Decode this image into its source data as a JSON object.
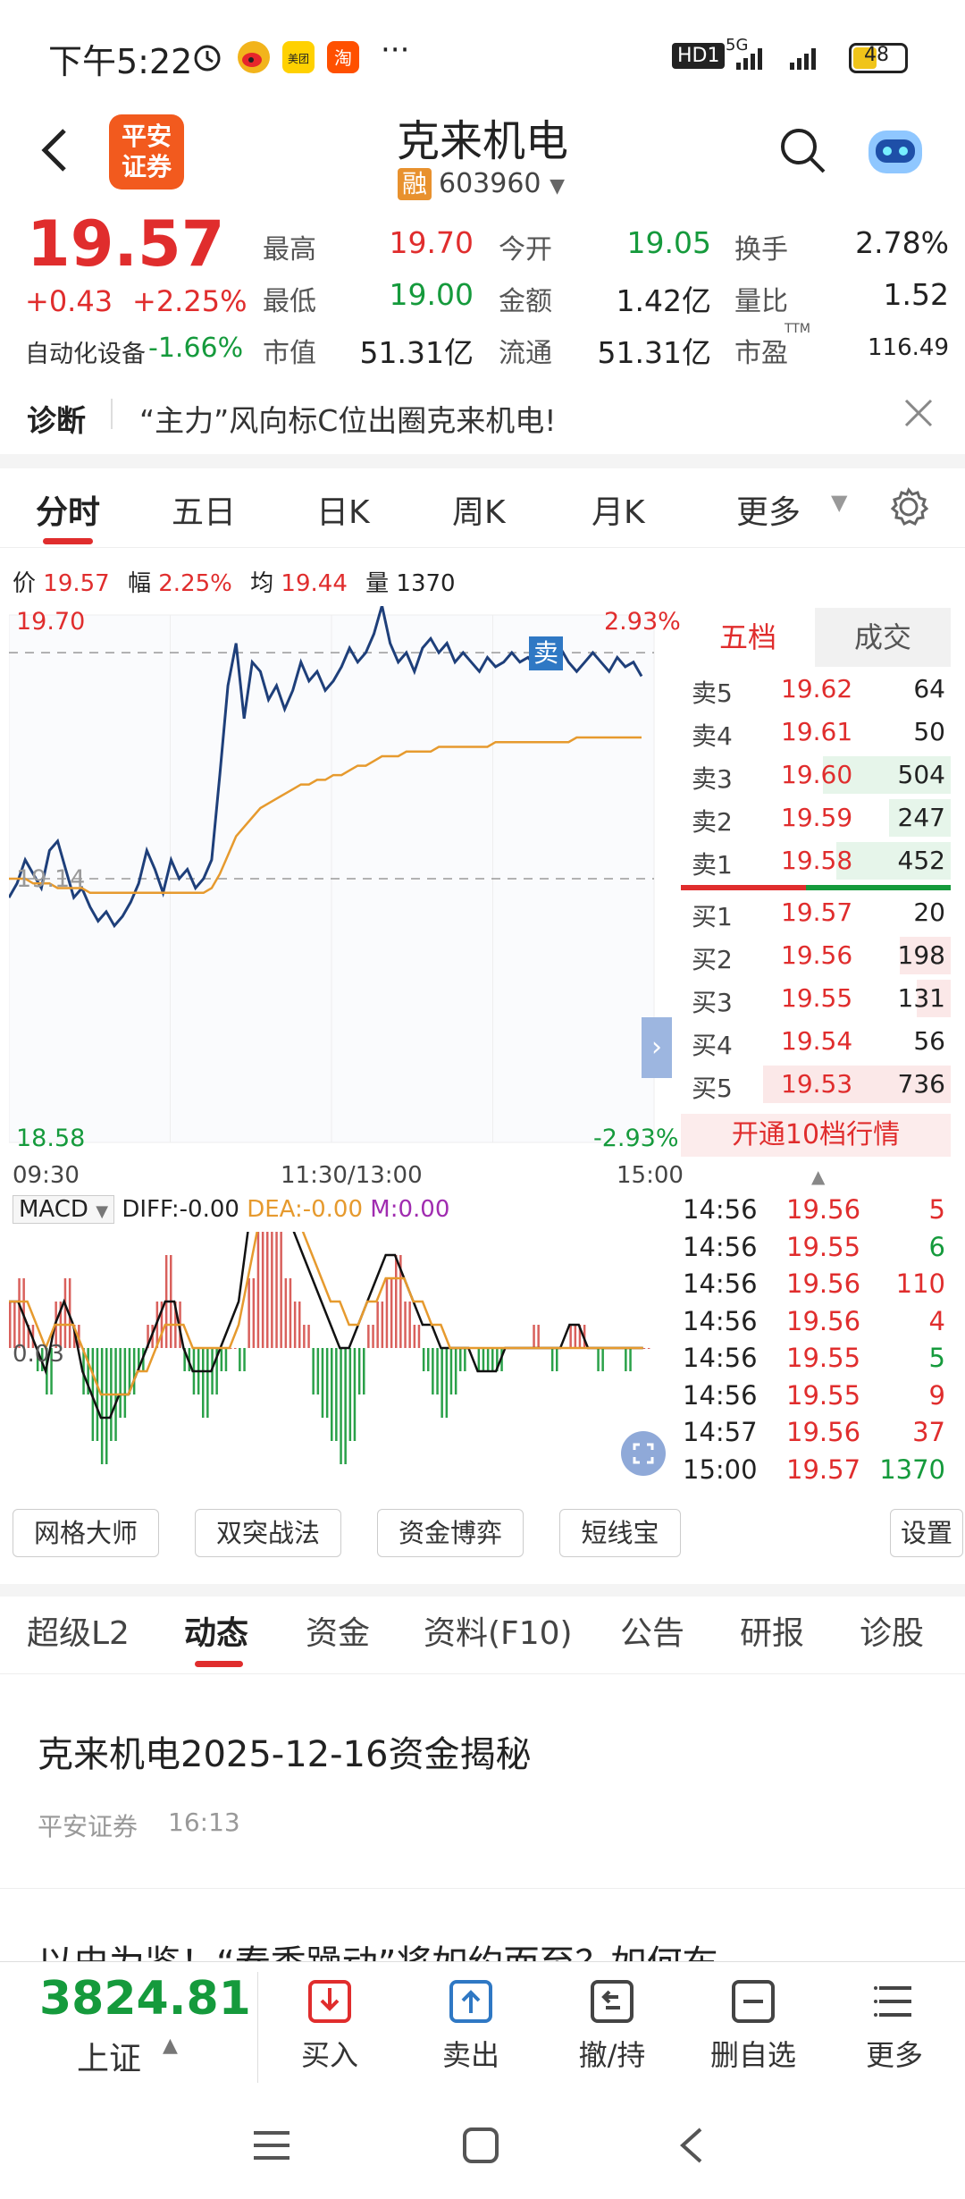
{
  "status_bar": {
    "time": "下午5:22",
    "network": "5G",
    "hd": "HD1",
    "battery": "48"
  },
  "header": {
    "broker_logo": "平安\n证券",
    "stock_name": "克来机电",
    "rong_badge": "融",
    "code": "603960"
  },
  "quote": {
    "price": "19.57",
    "change": "+0.43",
    "change_pct": "+2.25%",
    "sector_name": "自动化设备",
    "sector_pct": "-1.66%",
    "fields": [
      {
        "label": "最高",
        "value": "19.70",
        "color": "red"
      },
      {
        "label": "今开",
        "value": "19.05",
        "color": "green"
      },
      {
        "label": "换手",
        "value": "2.78%",
        "color": "black"
      },
      {
        "label": "最低",
        "value": "19.00",
        "color": "green"
      },
      {
        "label": "金额",
        "value": "1.42亿",
        "color": "black"
      },
      {
        "label": "量比",
        "value": "1.52",
        "color": "black"
      },
      {
        "label": "市值",
        "value": "51.31亿",
        "color": "black"
      },
      {
        "label": "流通",
        "value": "51.31亿",
        "color": "black"
      },
      {
        "label": "市盈",
        "value": "116.49",
        "color": "black",
        "sup": "TTM"
      }
    ]
  },
  "diagnosis": {
    "label": "诊断",
    "text": "“主力”风向标C位出圈克来机电!"
  },
  "chart_tabs": [
    "分时",
    "五日",
    "日K",
    "周K",
    "月K",
    "更多"
  ],
  "info_line": {
    "price_label": "价",
    "price": "19.57",
    "amp_label": "幅",
    "amp": "2.25%",
    "avg_label": "均",
    "avg": "19.44",
    "vol_label": "量",
    "vol": "1370"
  },
  "chart_data": {
    "type": "line",
    "title": "",
    "x_ticks": [
      "09:30",
      "11:30/13:00",
      "15:00"
    ],
    "y_left": {
      "max": "19.70",
      "mid": "19.14",
      "min": "18.58"
    },
    "y_right": {
      "max": "2.93%",
      "min": "-2.93%"
    },
    "ylim": [
      18.58,
      19.7
    ],
    "prev_close": 19.14,
    "sell_marker": "卖",
    "series": [
      {
        "values": [
          19.1,
          19.13,
          19.18,
          19.15,
          19.12,
          19.2,
          19.22,
          19.16,
          19.1,
          19.12,
          19.08,
          19.05,
          19.07,
          19.04,
          19.06,
          19.09,
          19.13,
          19.2,
          19.16,
          19.11,
          19.18,
          19.14,
          19.16,
          19.12,
          19.14,
          19.18,
          19.36,
          19.55,
          19.64,
          19.48,
          19.6,
          19.58,
          19.52,
          19.55,
          19.5,
          19.54,
          19.6,
          19.56,
          19.58,
          19.54,
          19.56,
          19.59,
          19.63,
          19.6,
          19.62,
          19.66,
          19.72,
          19.64,
          19.6,
          19.62,
          19.58,
          19.63,
          19.65,
          19.62,
          19.64,
          19.6,
          19.62,
          19.6,
          19.58,
          19.61,
          19.59,
          19.6,
          19.62,
          19.6,
          19.61,
          19.59,
          19.6,
          19.61,
          19.63,
          19.6,
          19.58,
          19.6,
          19.62,
          19.6,
          19.58,
          19.61,
          19.59,
          19.6,
          19.57
        ]
      },
      {
        "values": [
          19.14,
          19.14,
          19.14,
          19.13,
          19.13,
          19.13,
          19.12,
          19.12,
          19.12,
          19.12,
          19.11,
          19.11,
          19.11,
          19.11,
          19.11,
          19.11,
          19.11,
          19.11,
          19.11,
          19.11,
          19.11,
          19.11,
          19.11,
          19.11,
          19.11,
          19.12,
          19.15,
          19.19,
          19.23,
          19.25,
          19.27,
          19.29,
          19.3,
          19.31,
          19.32,
          19.33,
          19.34,
          19.34,
          19.35,
          19.35,
          19.36,
          19.36,
          19.37,
          19.38,
          19.38,
          19.39,
          19.4,
          19.4,
          19.4,
          19.41,
          19.41,
          19.41,
          19.41,
          19.42,
          19.42,
          19.42,
          19.42,
          19.42,
          19.42,
          19.42,
          19.43,
          19.43,
          19.43,
          19.43,
          19.43,
          19.43,
          19.43,
          19.43,
          19.43,
          19.43,
          19.44,
          19.44,
          19.44,
          19.44,
          19.44,
          19.44,
          19.44,
          19.44,
          19.44
        ]
      }
    ],
    "macd": {
      "label": "MACD",
      "diff": "DIFF:-0.00",
      "dea": "DEA:-0.00",
      "m": "M:0.00",
      "zero_label": "0.03",
      "bars": [
        0.02,
        0.03,
        0.01,
        -0.01,
        -0.02,
        0.02,
        0.03,
        0.01,
        -0.02,
        -0.04,
        -0.05,
        -0.04,
        -0.03,
        -0.02,
        -0.01,
        0.01,
        0.02,
        0.04,
        0.02,
        -0.01,
        -0.02,
        -0.03,
        -0.02,
        -0.01,
        0.0,
        -0.01,
        0.03,
        0.06,
        0.08,
        0.05,
        0.03,
        0.02,
        0.01,
        -0.02,
        -0.03,
        -0.04,
        -0.05,
        -0.04,
        -0.02,
        0.01,
        0.02,
        0.03,
        0.04,
        0.02,
        0.01,
        -0.01,
        -0.02,
        -0.03,
        -0.02,
        -0.01,
        0.0,
        -0.01,
        -0.01,
        -0.01,
        0.0,
        0.0,
        0.0,
        0.01,
        0.0,
        -0.01,
        0.0,
        0.01,
        0.01,
        0.0,
        -0.01,
        0.0,
        0.0,
        -0.01,
        0.0,
        0.0
      ],
      "diff_line": [
        0.02,
        0.02,
        0.01,
        0.0,
        -0.01,
        0.01,
        0.02,
        0.01,
        -0.01,
        -0.02,
        -0.03,
        -0.03,
        -0.02,
        -0.02,
        -0.01,
        0.0,
        0.01,
        0.02,
        0.02,
        0.0,
        -0.01,
        -0.01,
        -0.01,
        0.0,
        0.01,
        0.02,
        0.05,
        0.08,
        0.1,
        0.09,
        0.07,
        0.05,
        0.04,
        0.03,
        0.02,
        0.01,
        0.0,
        0.0,
        0.01,
        0.02,
        0.03,
        0.04,
        0.04,
        0.03,
        0.02,
        0.01,
        0.01,
        0.0,
        0.0,
        0.0,
        0.0,
        -0.01,
        -0.01,
        -0.01,
        0.0,
        0.0,
        0.0,
        0.0,
        0.0,
        0.0,
        0.0,
        0.01,
        0.01,
        0.0,
        0.0,
        0.0,
        0.0,
        0.0,
        0.0,
        0.0
      ],
      "dea_line": [
        0.02,
        0.02,
        0.02,
        0.01,
        0.0,
        0.01,
        0.01,
        0.01,
        0.0,
        -0.01,
        -0.02,
        -0.02,
        -0.02,
        -0.02,
        -0.01,
        -0.01,
        0.0,
        0.01,
        0.01,
        0.01,
        0.0,
        0.0,
        0.0,
        0.0,
        0.0,
        0.01,
        0.03,
        0.05,
        0.07,
        0.08,
        0.07,
        0.06,
        0.05,
        0.04,
        0.03,
        0.02,
        0.02,
        0.01,
        0.01,
        0.02,
        0.02,
        0.03,
        0.03,
        0.03,
        0.02,
        0.02,
        0.01,
        0.01,
        0.0,
        0.0,
        0.0,
        0.0,
        0.0,
        0.0,
        0.0,
        0.0,
        0.0,
        0.0,
        0.0,
        0.0,
        0.0,
        0.0,
        0.0,
        0.0,
        0.0,
        0.0,
        0.0,
        0.0,
        0.0,
        0.0
      ]
    }
  },
  "order_book": {
    "tabs": [
      "五档",
      "成交"
    ],
    "asks": [
      {
        "label": "卖5",
        "price": "19.62",
        "vol": "64",
        "bar": 0.0
      },
      {
        "label": "卖4",
        "price": "19.61",
        "vol": "50",
        "bar": 0.0
      },
      {
        "label": "卖3",
        "price": "19.60",
        "vol": "504",
        "bar": 0.68
      },
      {
        "label": "卖2",
        "price": "19.59",
        "vol": "247",
        "bar": 0.33
      },
      {
        "label": "卖1",
        "price": "19.58",
        "vol": "452",
        "bar": 0.61
      }
    ],
    "bids": [
      {
        "label": "买1",
        "price": "19.57",
        "vol": "20",
        "bar": 0.0
      },
      {
        "label": "买2",
        "price": "19.56",
        "vol": "198",
        "bar": 0.27
      },
      {
        "label": "买3",
        "price": "19.55",
        "vol": "131",
        "bar": 0.18
      },
      {
        "label": "买4",
        "price": "19.54",
        "vol": "56",
        "bar": 0.0
      },
      {
        "label": "买5",
        "price": "19.53",
        "vol": "736",
        "bar": 1.0
      }
    ],
    "open_level10": "开通10档行情"
  },
  "trades": [
    {
      "time": "14:56",
      "price": "19.56",
      "vol": "5",
      "color": "red"
    },
    {
      "time": "14:56",
      "price": "19.55",
      "vol": "6",
      "color": "green"
    },
    {
      "time": "14:56",
      "price": "19.56",
      "vol": "110",
      "color": "red"
    },
    {
      "time": "14:56",
      "price": "19.56",
      "vol": "4",
      "color": "red"
    },
    {
      "time": "14:56",
      "price": "19.55",
      "vol": "5",
      "color": "green"
    },
    {
      "time": "14:56",
      "price": "19.55",
      "vol": "9",
      "color": "red"
    },
    {
      "time": "14:57",
      "price": "19.56",
      "vol": "37",
      "color": "red"
    },
    {
      "time": "15:00",
      "price": "19.57",
      "vol": "1370",
      "color": "green"
    }
  ],
  "tools": [
    "网格大师",
    "双突战法",
    "资金博弈",
    "短线宝",
    "设置"
  ],
  "content_tabs": [
    "超级L2",
    "动态",
    "资金",
    "资料(F10)",
    "公告",
    "研报",
    "诊股"
  ],
  "articles": [
    {
      "title": "克来机电2025-12-16资金揭秘",
      "source": "平安证券",
      "time": "16:13"
    },
    {
      "title": "以史为鉴！“春季躁动”将如约而至？如何布"
    }
  ],
  "bottom_bar": {
    "index_value": "3824.81",
    "index_name": "上证",
    "actions": [
      "买入",
      "卖出",
      "撤/持",
      "删自选",
      "更多"
    ]
  }
}
